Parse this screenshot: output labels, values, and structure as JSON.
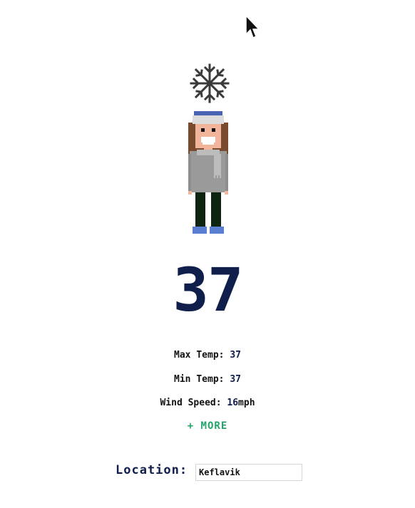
{
  "weather": {
    "condition_icon": "snowflake-icon",
    "temperature": "37",
    "max_temp_label": "Max Temp:",
    "max_temp_value": "37",
    "min_temp_label": "Min Temp:",
    "min_temp_value": "37",
    "wind_label": "Wind Speed:",
    "wind_value": "16",
    "wind_unit": "mph",
    "more_label": "+ MORE"
  },
  "location": {
    "label": "Location:",
    "value": "Keflavik"
  },
  "colors": {
    "temperature": "#0f1e4a",
    "more_link": "#22a46b",
    "beanie": "#4a64b4",
    "sweater": "#9a9a9a",
    "pants": "#0d2410",
    "shoes": "#5b7fd0",
    "hair": "#7a4a2e"
  }
}
